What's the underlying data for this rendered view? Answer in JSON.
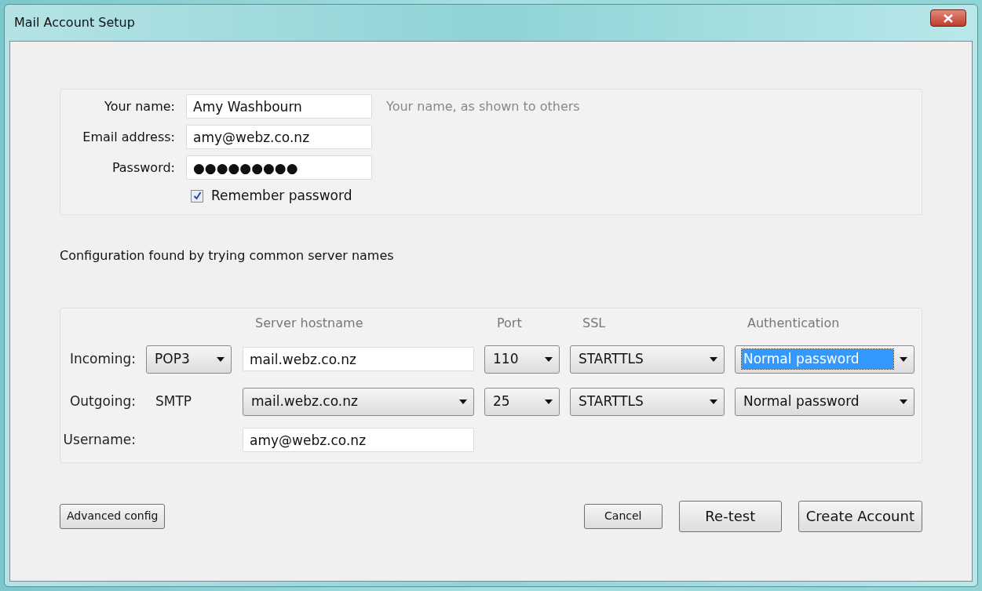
{
  "window": {
    "title": "Mail Account Setup"
  },
  "identity": {
    "fields": [
      {
        "label": "Your name:",
        "value": "Amy Washbourn",
        "hint": "Your name, as shown to others"
      },
      {
        "label": "Email address:",
        "value": "amy@webz.co.nz"
      },
      {
        "label": "Password:",
        "value": "●●●●●●●●●"
      }
    ],
    "remember": {
      "label": "Remember password",
      "checked": true
    }
  },
  "status": "Configuration found by trying common server names",
  "servers": {
    "columns": [
      "Server hostname",
      "Port",
      "SSL",
      "Authentication"
    ],
    "incoming": {
      "label": "Incoming:",
      "protocol": "POP3",
      "hostname": "mail.webz.co.nz",
      "port": "110",
      "ssl": "STARTTLS",
      "auth": "Normal password",
      "auth_focused": true
    },
    "outgoing": {
      "label": "Outgoing:",
      "protocol": "SMTP",
      "hostname": "mail.webz.co.nz",
      "port": "25",
      "ssl": "STARTTLS",
      "auth": "Normal password",
      "auth_focused": false
    },
    "username": {
      "label": "Username:",
      "value": "amy@webz.co.nz"
    }
  },
  "buttons": {
    "advanced": "Advanced config",
    "cancel": "Cancel",
    "retest": "Re-test",
    "create": "Create Account"
  }
}
